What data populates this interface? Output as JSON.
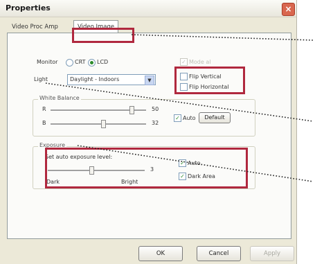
{
  "window": {
    "title": "Properties",
    "close_glyph": "×"
  },
  "tabs": [
    {
      "label": "Video Proc Amp",
      "selected": false
    },
    {
      "label": "Video Image",
      "selected": true
    }
  ],
  "monitor": {
    "label": "Monitor",
    "options": [
      "CRT",
      "LCD"
    ],
    "selected": "LCD"
  },
  "disabled_option": {
    "label": "Mode al"
  },
  "light": {
    "label": "Light",
    "value": "Daylight - Indoors"
  },
  "flip": {
    "vertical": "Flip Vertical",
    "horizontal": "Flip Horizontal"
  },
  "white_balance": {
    "label": "White Balance",
    "r_label": "R",
    "r_value": "50",
    "r_level": 0.85,
    "b_label": "B",
    "b_value": "32",
    "b_level": 0.55,
    "auto_label": "Auto",
    "auto_checked": true,
    "default_label": "Default"
  },
  "exposure": {
    "label": "Exposure",
    "set_auto_label": "Set auto exposure level:",
    "value": "3",
    "level": 0.45,
    "dark_label": "Dark",
    "bright_label": "Bright",
    "auto_label": "Auto",
    "auto_checked": true,
    "dark_area_label": "Dark Area",
    "dark_area_checked": true
  },
  "buttons": {
    "ok": "OK",
    "cancel": "Cancel",
    "apply": "Apply"
  },
  "colors": {
    "highlight": "#b0283e",
    "check": "#2a8a2a"
  }
}
